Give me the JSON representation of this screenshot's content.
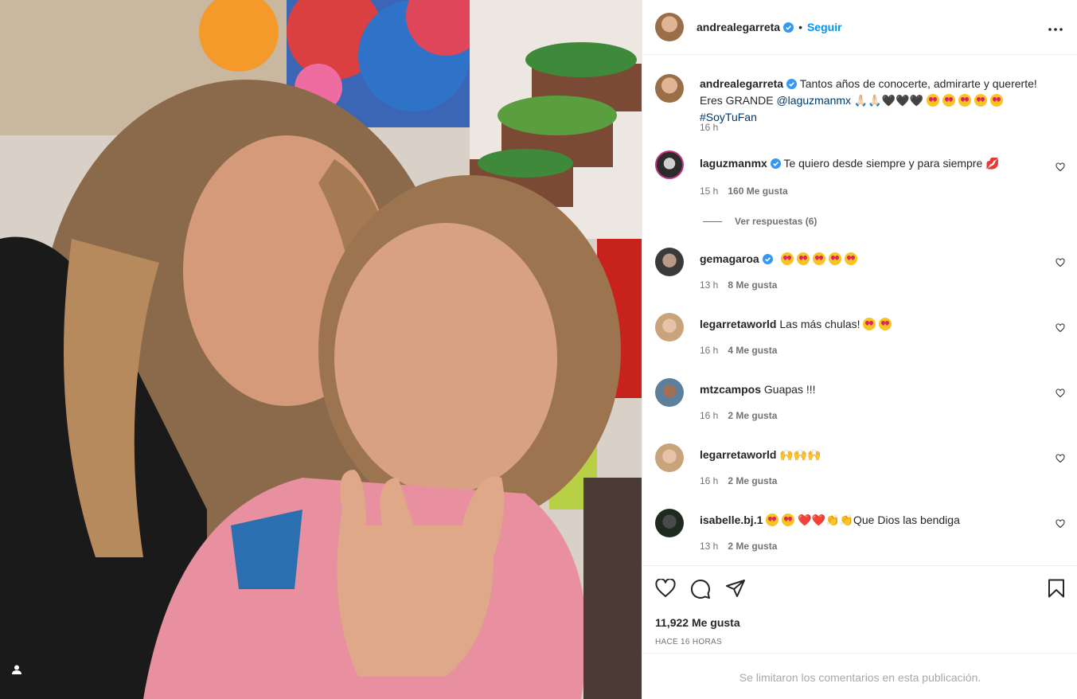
{
  "post": {
    "author": "andrealegarreta",
    "follow_label": "Seguir",
    "dot": "•",
    "caption_text_1": "Tantos años de conocerte, admirarte y quererte! Eres GRANDE ",
    "caption_mention": "@laguzmanmx",
    "caption_text_2": " 🙏🏻🙏🏻🖤🖤🖤",
    "caption_hashtag": "#SoyTuFan",
    "caption_time": "16 h",
    "likes": "11,922 Me gusta",
    "posted_ago": "HACE 16 HORAS",
    "comments_limited": "Se limitaron los comentarios en esta publicación."
  },
  "comments": [
    {
      "user": "laguzmanmx",
      "verified": true,
      "text": "Te quiero desde siempre y para siempre 💋",
      "time": "15 h",
      "likes": "160 Me gusta",
      "replies": "Ver respuestas (6)",
      "love_count": 0
    },
    {
      "user": "gemagaroa",
      "verified": true,
      "text": "",
      "time": "13 h",
      "likes": "8 Me gusta",
      "love_count": 5
    },
    {
      "user": "legarretaworld",
      "verified": false,
      "text": "Las más chulas!",
      "time": "16 h",
      "likes": "4 Me gusta",
      "love_count": 2
    },
    {
      "user": "mtzcampos",
      "verified": false,
      "text": "Guapas !!!",
      "time": "16 h",
      "likes": "2 Me gusta",
      "love_count": 0
    },
    {
      "user": "legarretaworld",
      "verified": false,
      "text": "🙌🙌🙌",
      "time": "16 h",
      "likes": "2 Me gusta",
      "love_count": 0
    },
    {
      "user": "isabelle.bj.1",
      "verified": false,
      "text": "❤️❤️👏👏Que Dios las bendiga",
      "time": "13 h",
      "likes": "2 Me gusta",
      "love_count": 2
    }
  ],
  "colors": {
    "accent": "#0095f6",
    "verified": "#3897f0",
    "text": "#262626",
    "muted": "#737373"
  },
  "icons": [
    "heart-icon",
    "comment-icon",
    "share-icon",
    "bookmark-icon",
    "more-icon",
    "user-tag-icon"
  ]
}
